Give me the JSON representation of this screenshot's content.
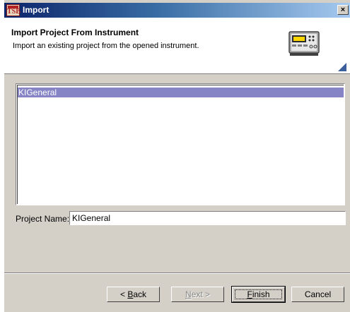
{
  "window": {
    "title": "Import",
    "app_icon_text": "TSB",
    "close_glyph": "×"
  },
  "header": {
    "title": "Import Project From Instrument",
    "description": "Import an existing project from the opened instrument.",
    "icon": "instrument-icon"
  },
  "project_list": {
    "items": [
      "KIGeneral"
    ],
    "selected": "KIGeneral"
  },
  "project_name": {
    "label": "Project Name:",
    "value": "KIGeneral"
  },
  "buttons": {
    "back": {
      "prefix": "< ",
      "accel": "B",
      "rest": "ack"
    },
    "next": {
      "accel": "N",
      "rest": "ext >"
    },
    "finish": {
      "accel": "F",
      "rest": "inish"
    },
    "cancel": "Cancel"
  }
}
